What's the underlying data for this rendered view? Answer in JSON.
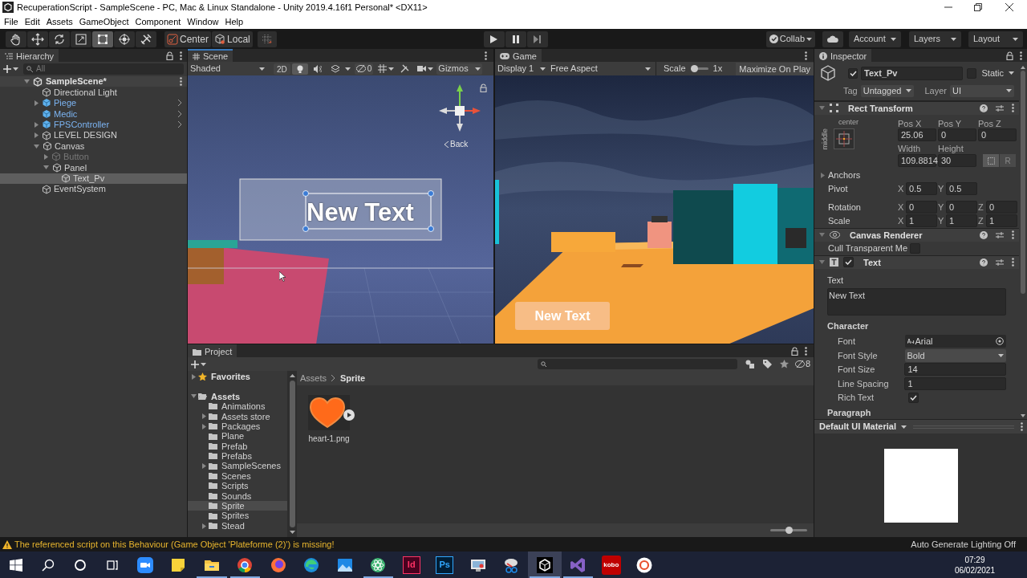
{
  "window": {
    "title": "RecuperationScript - SampleScene - PC, Mac & Linux Standalone - Unity 2019.4.16f1 Personal* <DX11>",
    "menu": [
      "File",
      "Edit",
      "Assets",
      "GameObject",
      "Component",
      "Window",
      "Help"
    ]
  },
  "toolbar": {
    "tools": [
      {
        "kind": "hand",
        "selected": false
      },
      {
        "kind": "move",
        "selected": false
      },
      {
        "kind": "rotate",
        "selected": false
      },
      {
        "kind": "scale",
        "selected": false
      },
      {
        "kind": "rect",
        "selected": true
      },
      {
        "kind": "transform",
        "selected": false
      },
      {
        "kind": "custom",
        "selected": false
      }
    ],
    "pivot_mode": "Center",
    "pivot_rotation": "Local",
    "collab": "Collab",
    "account": "Account",
    "layers": "Layers",
    "layout": "Layout"
  },
  "hierarchy": {
    "title": "Hierarchy",
    "focused": false,
    "search_placeholder": "All",
    "tree": [
      {
        "label": "SampleScene*",
        "kind": "scene",
        "expanded": true,
        "active": true,
        "selected": false,
        "children": [
          {
            "label": "Directional Light",
            "kind": "object",
            "active": true,
            "selected": false
          },
          {
            "label": "Piege",
            "kind": "prefab",
            "expanded": false,
            "active": true,
            "selected": false
          },
          {
            "label": "Medic",
            "kind": "prefab",
            "active": true,
            "selected": false
          },
          {
            "label": "FPSController",
            "kind": "prefab",
            "expanded": false,
            "active": true,
            "selected": false
          },
          {
            "label": "LEVEL DESIGN",
            "kind": "object",
            "expanded": false,
            "active": true,
            "selected": false
          },
          {
            "label": "Canvas",
            "kind": "object",
            "expanded": true,
            "active": true,
            "selected": false,
            "children": [
              {
                "label": "Button",
                "kind": "object",
                "expanded": false,
                "active": false,
                "selected": false
              },
              {
                "label": "Panel",
                "kind": "object",
                "expanded": true,
                "active": true,
                "selected": false,
                "children": [
                  {
                    "label": "Text_Pv",
                    "kind": "object",
                    "active": true,
                    "selected": true
                  }
                ]
              }
            ]
          },
          {
            "label": "EventSystem",
            "kind": "object",
            "active": true,
            "selected": false
          }
        ]
      }
    ]
  },
  "scene": {
    "title": "Scene",
    "focused": true,
    "shading": "Shaded",
    "mode_2d": "2D",
    "toggles": [
      {
        "kind": "lighting",
        "on": true
      },
      {
        "kind": "audio",
        "on": false
      },
      {
        "kind": "effects",
        "on": false
      }
    ],
    "hidden_count": "0",
    "gizmos": "Gizmos",
    "view_label": "Back",
    "canvas_text": "New Text"
  },
  "game": {
    "title": "Game",
    "focused": false,
    "display": "Display 1",
    "aspect": "Free Aspect",
    "scale_label": "Scale",
    "scale": {
      "level": 0.05
    },
    "scale_value": "1x",
    "maximize": "Maximize On Play",
    "canvas_text": "New Text"
  },
  "inspector": {
    "title": "Inspector",
    "focused": false,
    "object": {
      "name": "Text_Pv",
      "active": true,
      "static": false,
      "static_label": "Static",
      "tag_label": "Tag",
      "tag": "Untagged",
      "layer_label": "Layer",
      "layer": "UI"
    },
    "rect_transform": {
      "title": "Rect Transform",
      "anchor_h": "center",
      "anchor_v": "middle",
      "position": [
        {
          "label": "Pos X",
          "value": "25.06"
        },
        {
          "label": "Pos Y",
          "value": "0"
        },
        {
          "label": "Pos Z",
          "value": "0"
        }
      ],
      "size": [
        {
          "label": "Width",
          "value": "109.8814"
        },
        {
          "label": "Height",
          "value": "30"
        }
      ],
      "raw_label": "R",
      "anchors_label": "Anchors",
      "vectors": [
        {
          "label": "Pivot",
          "axes": [
            {
              "axis": "X",
              "value": "0.5"
            },
            {
              "axis": "Y",
              "value": "0.5"
            }
          ]
        },
        {
          "label": "Rotation",
          "axes": [
            {
              "axis": "X",
              "value": "0"
            },
            {
              "axis": "Y",
              "value": "0"
            },
            {
              "axis": "Z",
              "value": "0"
            }
          ]
        },
        {
          "label": "Scale",
          "axes": [
            {
              "axis": "X",
              "value": "1"
            },
            {
              "axis": "Y",
              "value": "1"
            },
            {
              "axis": "Z",
              "value": "1"
            }
          ]
        }
      ]
    },
    "canvas_renderer": {
      "title": "Canvas Renderer",
      "cull_label": "Cull Transparent Me",
      "cull": false
    },
    "text_component": {
      "title": "Text",
      "enabled": true,
      "text_label": "Text",
      "text": "New Text",
      "character_label": "Character",
      "props": [
        {
          "label": "Font",
          "kind": "object",
          "value": "Arial"
        },
        {
          "label": "Font Style",
          "kind": "dropdown",
          "value": "Bold"
        },
        {
          "label": "Font Size",
          "kind": "field",
          "value": "14"
        },
        {
          "label": "Line Spacing",
          "kind": "field",
          "value": "1"
        },
        {
          "label": "Rich Text",
          "kind": "checkbox",
          "checked": true
        }
      ],
      "paragraph_label": "Paragraph"
    },
    "material": {
      "title": "Default UI Material"
    }
  },
  "project": {
    "title": "Project",
    "focused": false,
    "hidden_count": "8",
    "tree": [
      {
        "label": "Favorites",
        "kind": "favorites",
        "expanded": false,
        "selected": false
      },
      {
        "label": "Assets",
        "kind": "root",
        "expanded": true,
        "selected": false,
        "children": [
          {
            "label": "Animations",
            "kind": "folder",
            "selected": false
          },
          {
            "label": "Assets store",
            "kind": "folder",
            "expanded": false,
            "selected": false
          },
          {
            "label": "Packages",
            "kind": "folder",
            "expanded": false,
            "selected": false
          },
          {
            "label": "Plane",
            "kind": "folder",
            "selected": false
          },
          {
            "label": "Prefab",
            "kind": "folder",
            "selected": false
          },
          {
            "label": "Prefabs",
            "kind": "folder",
            "selected": false
          },
          {
            "label": "SampleScenes",
            "kind": "folder",
            "expanded": false,
            "selected": false
          },
          {
            "label": "Scenes",
            "kind": "folder",
            "selected": false
          },
          {
            "label": "Scripts",
            "kind": "folder",
            "selected": false
          },
          {
            "label": "Sounds",
            "kind": "folder",
            "selected": false
          },
          {
            "label": "Sprite",
            "kind": "folder",
            "selected": true
          },
          {
            "label": "Sprites",
            "kind": "folder",
            "selected": false
          },
          {
            "label": "Stead",
            "kind": "folder",
            "expanded": false,
            "selected": false
          }
        ]
      }
    ],
    "breadcrumb": [
      "Assets",
      "Sprite"
    ],
    "assets": [
      {
        "label": "heart-1.png"
      }
    ],
    "size_slider": {
      "level": 0.52
    }
  },
  "status_bar": {
    "warning": true,
    "message": "The referenced script on this Behaviour (Game Object 'Plateforme (2)') is missing!",
    "lighting": "Auto Generate Lighting Off"
  },
  "taskbar": {
    "system": [
      {
        "kind": "start"
      },
      {
        "kind": "search"
      },
      {
        "kind": "cortana"
      },
      {
        "kind": "task-view"
      }
    ],
    "apps": [
      {
        "kind": "zoom",
        "running": false,
        "active": false
      },
      {
        "kind": "sticky",
        "running": false,
        "active": false
      },
      {
        "kind": "explorer",
        "running": true,
        "active": false
      },
      {
        "kind": "chrome",
        "running": true,
        "active": false
      },
      {
        "kind": "firefox",
        "running": false,
        "active": false
      },
      {
        "kind": "edge",
        "running": false,
        "active": false
      },
      {
        "kind": "photos",
        "running": false,
        "active": false
      },
      {
        "kind": "atom",
        "running": true,
        "active": false
      },
      {
        "kind": "indesign",
        "label": "Id",
        "running": false,
        "active": false
      },
      {
        "kind": "photoshop",
        "label": "Ps",
        "running": false,
        "active": false
      },
      {
        "kind": "remote",
        "running": false,
        "active": false
      },
      {
        "kind": "snip",
        "running": false,
        "active": false
      },
      {
        "kind": "unity",
        "running": true,
        "active": true
      },
      {
        "kind": "visualstudio",
        "running": true,
        "active": false
      },
      {
        "kind": "kobo",
        "label": "kobo",
        "running": false,
        "active": false
      },
      {
        "kind": "ring",
        "running": false,
        "active": false
      }
    ],
    "time": "07:29",
    "date": "06/02/2021"
  }
}
